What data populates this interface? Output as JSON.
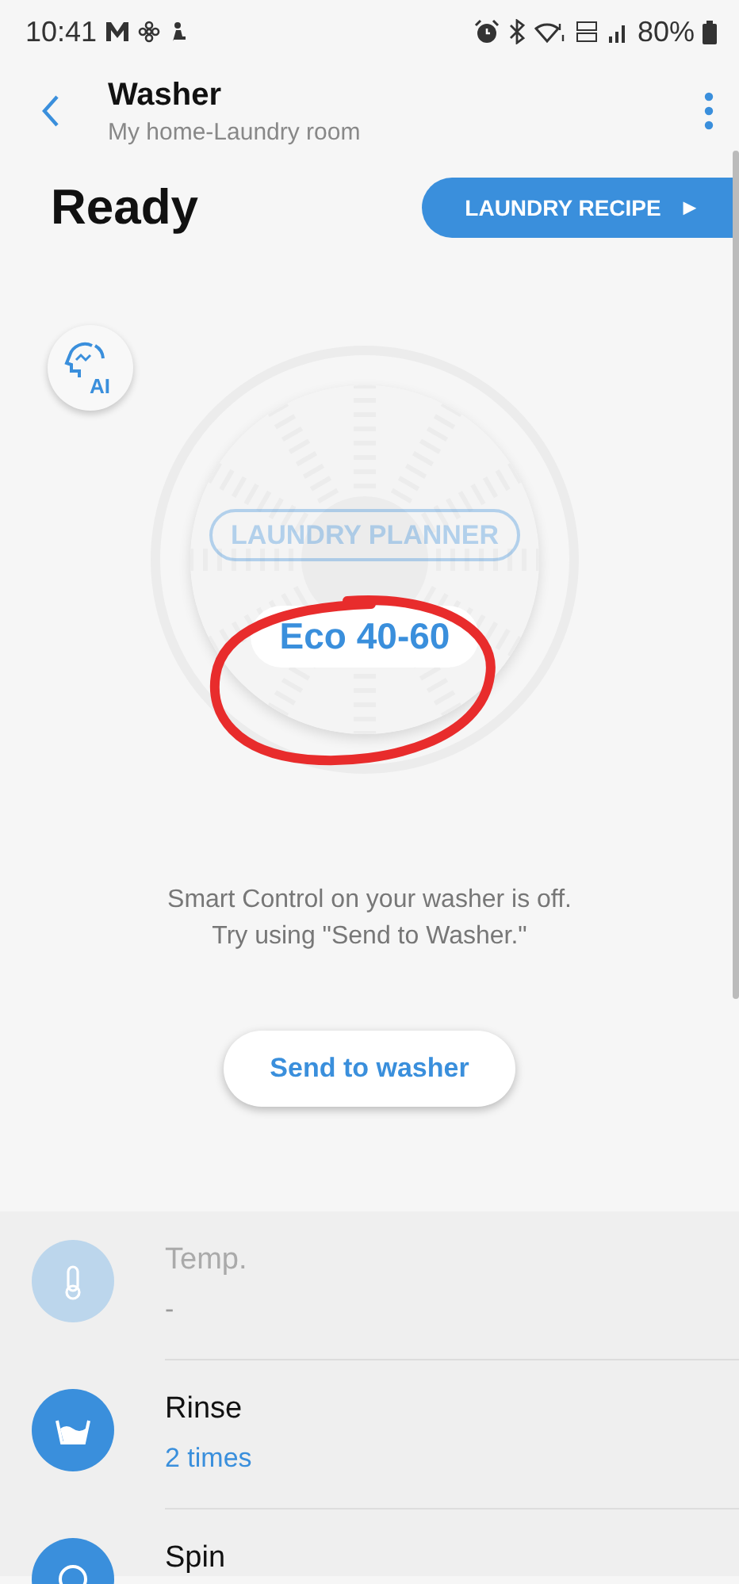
{
  "status_bar": {
    "time": "10:41",
    "battery": "80%"
  },
  "header": {
    "title": "Washer",
    "subtitle": "My home-Laundry room"
  },
  "state": "Ready",
  "recipe_button": {
    "label": "LAUNDRY RECIPE",
    "arrow": "▶"
  },
  "ai_button": {
    "label": "AI"
  },
  "drum": {
    "planner_button": {
      "label": "LAUNDRY PLANNER",
      "disabled": true
    },
    "course": "Eco 40-60",
    "annotated": true
  },
  "message": [
    "Smart Control on your washer is off.",
    "Try using \"Send to Washer.\""
  ],
  "send_button": {
    "label": "Send to washer"
  },
  "options": [
    {
      "kind": "temp",
      "label": "Temp.",
      "value": "-",
      "disabled": true
    },
    {
      "kind": "rinse",
      "label": "Rinse",
      "value": "2 times",
      "disabled": false
    },
    {
      "kind": "spin",
      "label": "Spin",
      "disabled": false
    }
  ]
}
